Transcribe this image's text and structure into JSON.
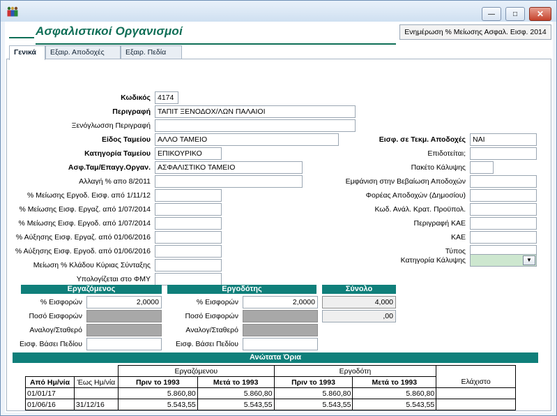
{
  "window": {
    "buttons": {
      "minimize": "—",
      "maximize": "□",
      "close": "✕"
    }
  },
  "header": {
    "title": "Ασφαλιστικοί Οργανισμοί",
    "action_box": "Ενημέρωση % Μείωσης Ασφαλ. Εισφ. 2014"
  },
  "tabs": [
    "Γενικά",
    "Εξαιρ. Αποδοχές",
    "Εξαιρ. Πεδία"
  ],
  "left_fields": [
    {
      "label": "Κωδικός",
      "value": "4174",
      "bold": true
    },
    {
      "label": "Περιγραφή",
      "value": "ΤΑΠΙΤ ΞΕΝΟΔΟΧ/ΛΩΝ ΠΑΛΑΙΟΙ",
      "bold": true
    },
    {
      "label": "Ξενόγλωσση Περιγραφή",
      "value": "",
      "bold": false
    },
    {
      "label": "Είδος Ταμείου",
      "value": "ΑΛΛΟ ΤΑΜΕΙΟ",
      "bold": true
    },
    {
      "label": "Κατηγορία Ταμείου",
      "value": "ΕΠΙΚΟΥΡΙΚΟ",
      "bold": true
    },
    {
      "label": "Ασφ.Ταμ/Επαγγ.Οργαν.",
      "value": "ΑΣΦΑΛΙΣΤΙΚΟ ΤΑΜΕΙΟ",
      "bold": true
    },
    {
      "label": "Αλλαγή % απο 8/2011",
      "value": "",
      "bold": false
    },
    {
      "label": "% Μείωσης Εργοδ. Εισφ. από 1/11/12",
      "value": "",
      "bold": false
    },
    {
      "label": "% Μείωσης Εισφ. Εργαζ. από 1/07/2014",
      "value": "",
      "bold": false
    },
    {
      "label": "% Μείωσης Εισφ. Εργοδ. από 1/07/2014",
      "value": "",
      "bold": false
    },
    {
      "label": "% Αύξησης Εισφ. Εργαζ. από 01/06/2016",
      "value": "",
      "bold": false
    },
    {
      "label": "% Αύξησης Εισφ. Εργοδ. από 01/06/2016",
      "value": "",
      "bold": false
    },
    {
      "label": "Μείωση % Κλάδου Κύριας Σύνταξης",
      "value": "",
      "bold": false
    },
    {
      "label": "Υπολογίζεται στο ΦΜΥ",
      "value": "",
      "bold": false
    }
  ],
  "right_fields": [
    {
      "label": "Εισφ. σε Τεκμ. Αποδοχές",
      "value": "ΝΑΙ",
      "bold": true
    },
    {
      "label": "Επιδοτείται;",
      "value": "",
      "bold": false
    },
    {
      "label": "Πακέτο Κάλυψης",
      "value": "",
      "bold": false
    },
    {
      "label": "Εμφάνιση στην Βεβαίωση Αποδοχών",
      "value": "",
      "bold": false
    },
    {
      "label": "Φορέας Αποδοχών (Δημοσίου)",
      "value": "",
      "bold": false
    },
    {
      "label": "Κωδ. Ανάλ. Κρατ. Προϋπολ.",
      "value": "",
      "bold": false
    },
    {
      "label": "Περιγραφή ΚΑΕ",
      "value": "",
      "bold": false
    },
    {
      "label": "ΚΑΕ",
      "value": "",
      "bold": false
    },
    {
      "label": "Τύπος",
      "value": "",
      "bold": false
    },
    {
      "label": "Κατηγορία Κάλυψης",
      "value": "",
      "bold": false
    }
  ],
  "employee": {
    "title": "Εργαζόμενος",
    "labels": [
      "% Εισφορών",
      "Ποσό Εισφορών",
      "Αναλογ/Σταθερό",
      "Εισφ. Βάσει Πεδίου"
    ],
    "values": [
      "2,0000",
      "",
      "",
      ""
    ]
  },
  "employer": {
    "title": "Εργοδότης",
    "labels": [
      "% Εισφορών",
      "Ποσό Εισφορών",
      "Αναλογ/Σταθερό",
      "Εισφ. Βάσει Πεδίου"
    ],
    "values": [
      "2,0000",
      "",
      "",
      ""
    ]
  },
  "total": {
    "title": "Σύνολο",
    "values": [
      "4,000",
      ",00"
    ]
  },
  "limits": {
    "title": "Ανώτατα    Όρια",
    "group_headers": [
      "Εργαζόμενου",
      "Εργοδότη",
      "Ελάχιστο"
    ],
    "columns": [
      "Από Ημ/νία",
      "Έως Ημ/νία",
      "Πριν το 1993",
      "Μετά το 1993",
      "Πριν το 1993",
      "Μετά το 1993"
    ],
    "rows": [
      [
        "01/01/17",
        "",
        "5.860,80",
        "5.860,80",
        "5.860,80",
        "5.860,80",
        ""
      ],
      [
        "01/06/16",
        "31/12/16",
        "5.543,55",
        "5.543,55",
        "5.543,55",
        "5.543,55",
        ""
      ]
    ]
  }
}
